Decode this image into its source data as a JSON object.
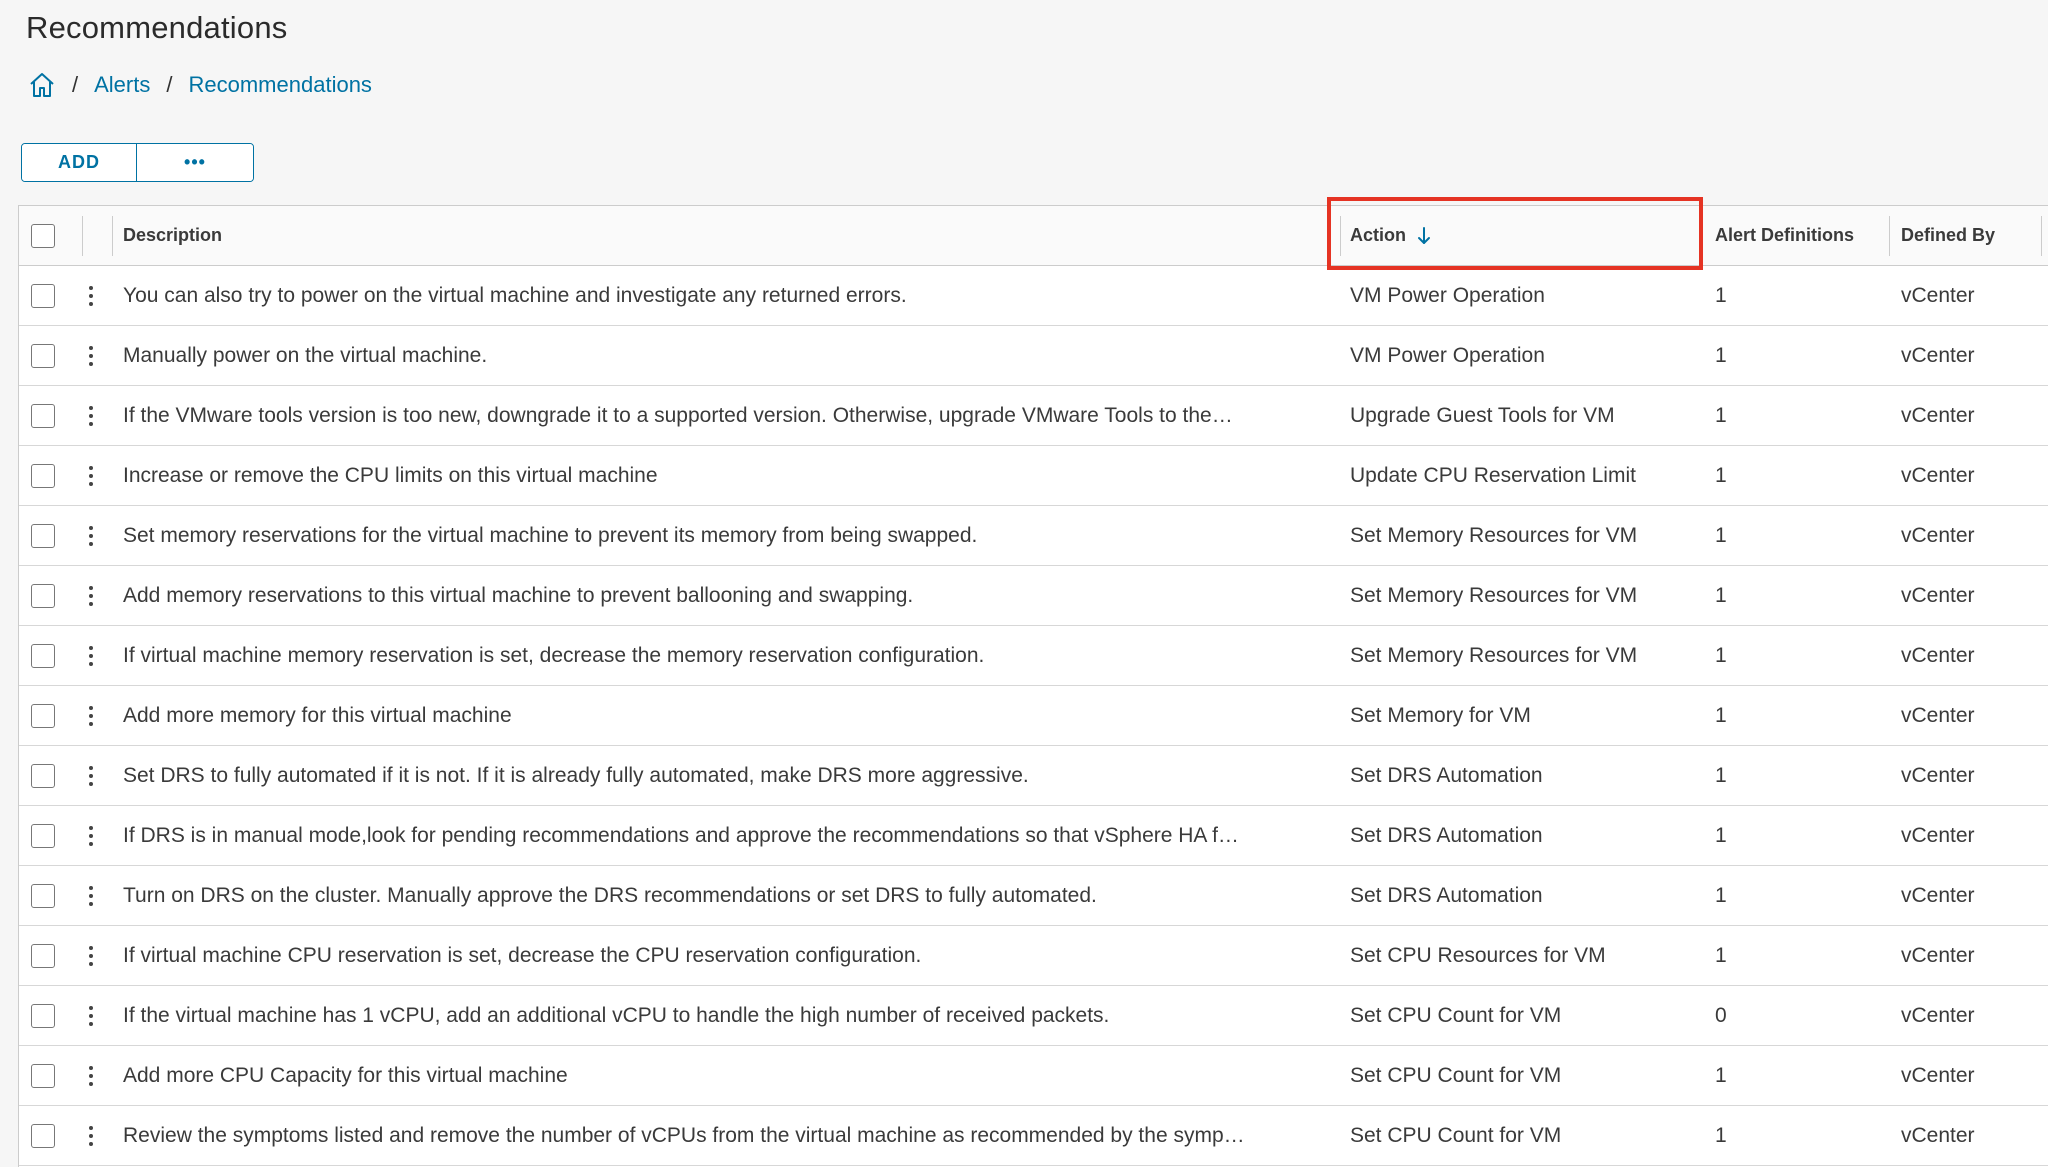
{
  "page": {
    "title": "Recommendations"
  },
  "breadcrumb": {
    "home_icon": "home-icon",
    "separator": "/",
    "items": [
      "Alerts",
      "Recommendations"
    ]
  },
  "toolbar": {
    "add_label": "ADD",
    "more_label": "•••"
  },
  "table": {
    "columns": {
      "description": "Description",
      "action": "Action",
      "alert_definitions": "Alert Definitions",
      "defined_by": "Defined By"
    },
    "sort": {
      "column": "Action",
      "direction": "descending",
      "icon": "arrow-down-icon"
    },
    "rows": [
      {
        "description": "You can also try to power on the virtual machine and investigate any returned errors.",
        "action": "VM Power Operation",
        "alert_definitions": "1",
        "defined_by": "vCenter"
      },
      {
        "description": "Manually power on the virtual machine.",
        "action": "VM Power Operation",
        "alert_definitions": "1",
        "defined_by": "vCenter"
      },
      {
        "description": "If the VMware tools version is too new, downgrade it to a supported version. Otherwise, upgrade VMware Tools to the…",
        "action": "Upgrade Guest Tools for VM",
        "alert_definitions": "1",
        "defined_by": "vCenter"
      },
      {
        "description": "Increase or remove the CPU limits on this virtual machine",
        "action": "Update CPU Reservation Limit",
        "alert_definitions": "1",
        "defined_by": "vCenter"
      },
      {
        "description": "Set memory reservations for the virtual machine to prevent its memory from being swapped.",
        "action": "Set Memory Resources for VM",
        "alert_definitions": "1",
        "defined_by": "vCenter"
      },
      {
        "description": "Add memory reservations to this virtual machine to prevent ballooning and swapping.",
        "action": "Set Memory Resources for VM",
        "alert_definitions": "1",
        "defined_by": "vCenter"
      },
      {
        "description": "If virtual machine memory reservation is set, decrease the memory reservation configuration.",
        "action": "Set Memory Resources for VM",
        "alert_definitions": "1",
        "defined_by": "vCenter"
      },
      {
        "description": "Add more memory for this virtual machine",
        "action": "Set Memory for VM",
        "alert_definitions": "1",
        "defined_by": "vCenter"
      },
      {
        "description": "Set DRS to fully automated if it is not. If it is already fully automated, make DRS more aggressive.",
        "action": "Set DRS Automation",
        "alert_definitions": "1",
        "defined_by": "vCenter"
      },
      {
        "description": "If DRS is in manual mode,look for pending recommendations and approve the recommendations so that vSphere HA f…",
        "action": "Set DRS Automation",
        "alert_definitions": "1",
        "defined_by": "vCenter"
      },
      {
        "description": "Turn on DRS on the cluster. Manually approve the DRS recommendations or set DRS to fully automated.",
        "action": "Set DRS Automation",
        "alert_definitions": "1",
        "defined_by": "vCenter"
      },
      {
        "description": "If virtual machine CPU reservation is set, decrease the CPU reservation configuration.",
        "action": "Set CPU Resources for VM",
        "alert_definitions": "1",
        "defined_by": "vCenter"
      },
      {
        "description": "If the virtual machine has 1 vCPU, add an additional vCPU to handle the high number of received packets.",
        "action": "Set CPU Count for VM",
        "alert_definitions": "0",
        "defined_by": "vCenter"
      },
      {
        "description": "Add more CPU Capacity for this virtual machine",
        "action": "Set CPU Count for VM",
        "alert_definitions": "1",
        "defined_by": "vCenter"
      },
      {
        "description": "Review the symptoms listed and remove the number of vCPUs from the virtual machine as recommended by the symp…",
        "action": "Set CPU Count for VM",
        "alert_definitions": "1",
        "defined_by": "vCenter"
      }
    ]
  },
  "colors": {
    "link": "#0072a3",
    "highlight": "#e53323"
  }
}
